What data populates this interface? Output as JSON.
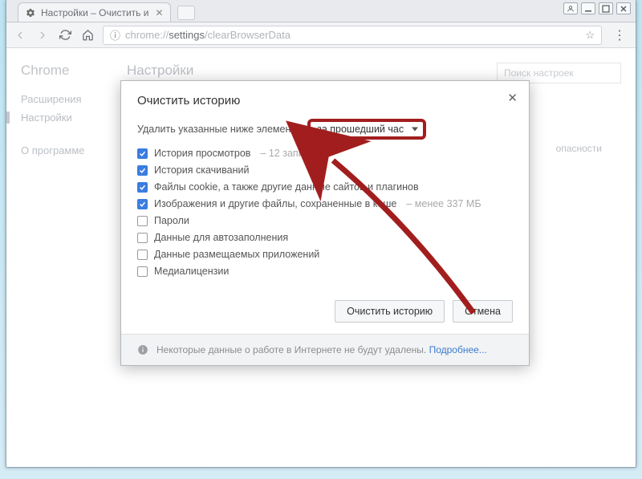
{
  "window": {
    "tab_title": "Настройки – Очистить и",
    "url_prefix": "chrome://",
    "url_path": "settings",
    "url_suffix": "/clearBrowserData"
  },
  "sidebar": {
    "brand": "Chrome",
    "items": [
      "Расширения",
      "Настройки",
      "О программе"
    ]
  },
  "main_title": "Настройки",
  "right_hint": "Поиск настроек",
  "menu_item_partial": "опасности",
  "modal": {
    "title": "Очистить историю",
    "prompt": "Удалить указанные ниже элементы",
    "time_value": "за прошедший час",
    "items": [
      {
        "label": "История просмотров",
        "note": "– 12 записей",
        "checked": true
      },
      {
        "label": "История скачиваний",
        "note": "",
        "checked": true
      },
      {
        "label": "Файлы cookie, а также другие данные сайтов и плагинов",
        "note": "",
        "checked": true
      },
      {
        "label": "Изображения и другие файлы, сохраненные в кеше",
        "note": "– менее 337 МБ",
        "checked": true
      },
      {
        "label": "Пароли",
        "note": "",
        "checked": false
      },
      {
        "label": "Данные для автозаполнения",
        "note": "",
        "checked": false
      },
      {
        "label": "Данные размещаемых приложений",
        "note": "",
        "checked": false
      },
      {
        "label": "Медиалицензии",
        "note": "",
        "checked": false
      }
    ],
    "actions": {
      "primary": "Очистить историю",
      "cancel": "Отмена"
    },
    "footer_text": "Некоторые данные о работе в Интернете не будут удалены.",
    "footer_link": "Подробнее..."
  }
}
